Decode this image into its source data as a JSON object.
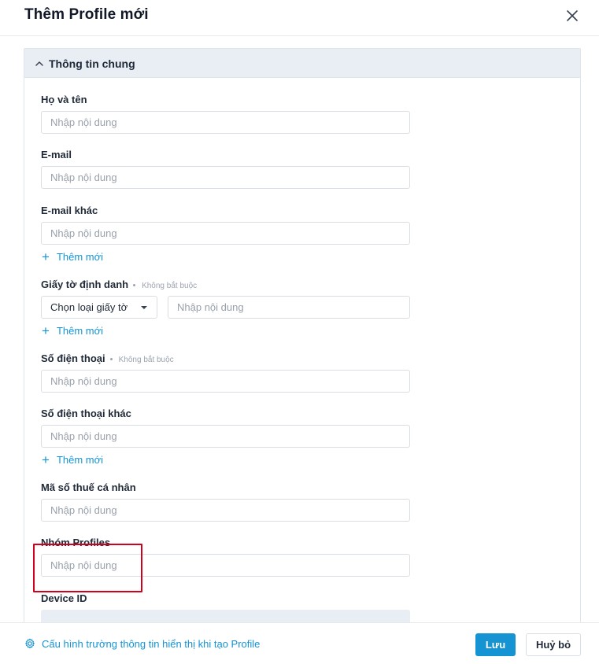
{
  "dialog": {
    "title": "Thêm Profile mới",
    "close_icon": "close-icon"
  },
  "section": {
    "title": "Thông tin chung",
    "toggle_icon": "chevron-up-icon"
  },
  "fields": {
    "full_name": {
      "label": "Họ và tên",
      "placeholder": "Nhập nội dung",
      "value": ""
    },
    "email": {
      "label": "E-mail",
      "placeholder": "Nhập nội dung",
      "value": ""
    },
    "email_other": {
      "label": "E-mail khác",
      "placeholder": "Nhập nội dung",
      "value": "",
      "add_label": "Thêm mới"
    },
    "id_document": {
      "label": "Giấy tờ định danh",
      "optional": "Không bắt buộc",
      "select_value": "Chọn loại giấy tờ",
      "placeholder": "Nhập nội dung",
      "value": "",
      "add_label": "Thêm mới"
    },
    "phone": {
      "label": "Số điện thoại",
      "optional": "Không bắt buộc",
      "placeholder": "Nhập nội dung",
      "value": ""
    },
    "phone_other": {
      "label": "Số điện thoại khác",
      "placeholder": "Nhập nội dung",
      "value": "",
      "add_label": "Thêm mới"
    },
    "tax_code": {
      "label": "Mã số thuế cá nhân",
      "placeholder": "Nhập nội dung",
      "value": ""
    },
    "profile_group": {
      "label": "Nhóm Profiles",
      "placeholder": "Nhập nội dung",
      "value": ""
    },
    "device_id": {
      "label": "Device ID"
    }
  },
  "footer": {
    "config_link": "Cấu hình trường thông tin hiển thị khi tạo Profile",
    "config_icon": "gear-icon",
    "save_label": "Lưu",
    "cancel_label": "Huỷ bỏ"
  },
  "colors": {
    "accent": "#1593d3",
    "highlight": "#d0021b",
    "section_header_bg": "#e9eef4"
  }
}
